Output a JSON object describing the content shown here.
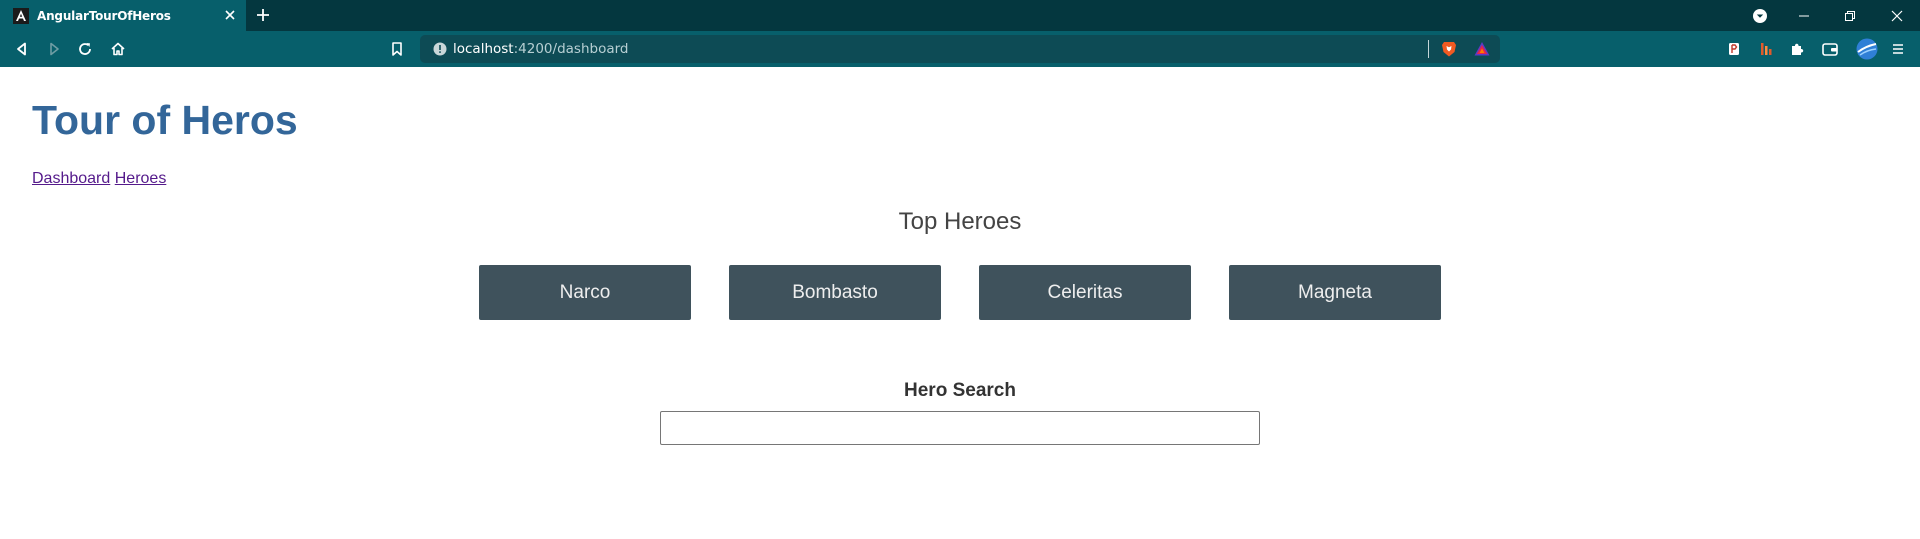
{
  "browser": {
    "tab": {
      "title": "AngularTourOfHeros"
    },
    "address": {
      "host": "localhost",
      "path": ":4200/dashboard"
    }
  },
  "app": {
    "title": "Tour of Heros",
    "nav": [
      {
        "label": "Dashboard"
      },
      {
        "label": "Heroes"
      }
    ]
  },
  "dashboard": {
    "heading": "Top Heroes",
    "heroes": [
      {
        "name": "Narco"
      },
      {
        "name": "Bombasto"
      },
      {
        "name": "Celeritas"
      },
      {
        "name": "Magneta"
      }
    ]
  },
  "search": {
    "heading": "Hero Search",
    "value": ""
  },
  "colors": {
    "chrome_dark": "#04373f",
    "chrome_teal": "#075f6b",
    "title_blue": "#336699",
    "hero_card": "#3f525c",
    "link_visited": "#551a8b"
  },
  "icons": {
    "tab_favicon": "angular-logo-icon",
    "tab_close": "close-icon",
    "new_tab": "plus-icon",
    "back": "back-arrow-icon",
    "forward": "forward-arrow-icon",
    "reload": "reload-icon",
    "home": "home-icon",
    "bookmark": "bookmark-icon",
    "site_info": "info-icon",
    "brave_shields": "brave-shield-icon",
    "brave_rewards": "rewards-triangle-icon",
    "extensions": "puzzle-icon",
    "wallet": "wallet-icon",
    "menu": "hamburger-menu-icon"
  }
}
